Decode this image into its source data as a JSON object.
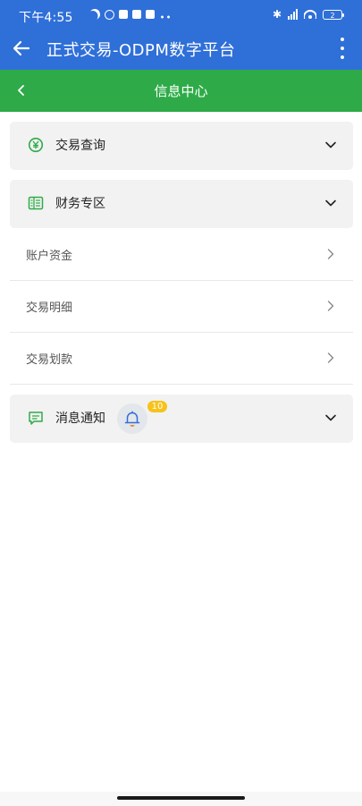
{
  "status_bar": {
    "time": "下午4:55",
    "battery": "2"
  },
  "app_bar": {
    "title": "正式交易-ODPM数字平台"
  },
  "sub_header": {
    "title": "信息中心"
  },
  "sections": {
    "trade_query": {
      "label": "交易查询",
      "icon": "yen-circle-icon"
    },
    "finance": {
      "label": "财务专区",
      "icon": "ledger-icon"
    },
    "finance_items": [
      {
        "label": "账户资金"
      },
      {
        "label": "交易明细"
      },
      {
        "label": "交易划款"
      }
    ],
    "notice": {
      "label": "消息通知",
      "icon": "message-icon",
      "badge": "10"
    }
  },
  "colors": {
    "primary_blue": "#2f6fd8",
    "header_green": "#2eab48",
    "card_bg": "#f2f2f2",
    "badge_yellow": "#f7c21b"
  }
}
